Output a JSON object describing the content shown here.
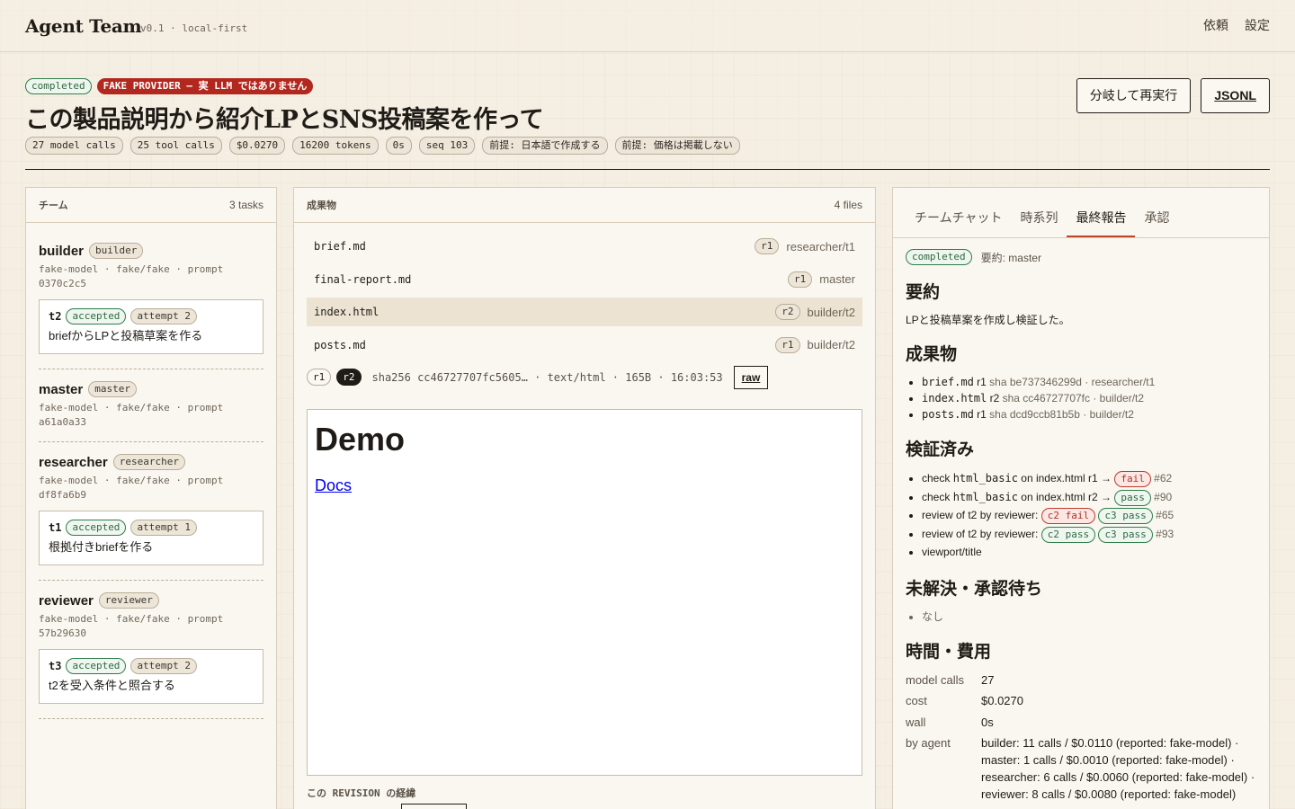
{
  "app": {
    "name": "Agent Team",
    "meta": "v0.1 · local-first"
  },
  "nav": {
    "request": "依頼",
    "settings": "設定"
  },
  "run": {
    "status": "completed",
    "warning": "FAKE PROVIDER — 実 LLM ではありません",
    "title": "この製品説明から紹介LPとSNS投稿案を作って",
    "stats": [
      "27 model calls",
      "25 tool calls",
      "$0.0270",
      "16200 tokens",
      "0s",
      "seq 103",
      "前提: 日本語で作成する",
      "前提: 価格は掲載しない"
    ],
    "fork_label": "分岐して再実行",
    "jsonl_label": "JSONL"
  },
  "team": {
    "title": "チーム",
    "count": "3 tasks",
    "agents": [
      {
        "name": "builder",
        "role": "builder",
        "meta": "fake-model · fake/fake · prompt 0370c2c5",
        "tasks": [
          {
            "id": "t2",
            "status": "accepted",
            "attempt": "attempt 2",
            "desc": "briefからLPと投稿草案を作る"
          }
        ]
      },
      {
        "name": "master",
        "role": "master",
        "meta": "fake-model · fake/fake · prompt a61a0a33",
        "tasks": []
      },
      {
        "name": "researcher",
        "role": "researcher",
        "meta": "fake-model · fake/fake · prompt df8fa6b9",
        "tasks": [
          {
            "id": "t1",
            "status": "accepted",
            "attempt": "attempt 1",
            "desc": "根拠付きbriefを作る"
          }
        ]
      },
      {
        "name": "reviewer",
        "role": "reviewer",
        "meta": "fake-model · fake/fake · prompt 57b29630",
        "tasks": [
          {
            "id": "t3",
            "status": "accepted",
            "attempt": "attempt 2",
            "desc": "t2を受入条件と照合する"
          }
        ]
      }
    ]
  },
  "artifacts": {
    "title": "成果物",
    "count": "4 files",
    "files": [
      {
        "name": "brief.md",
        "rev": "r1",
        "owner": "researcher/t1"
      },
      {
        "name": "final-report.md",
        "rev": "r1",
        "owner": "master"
      },
      {
        "name": "index.html",
        "rev": "r2",
        "owner": "builder/t2"
      },
      {
        "name": "posts.md",
        "rev": "r1",
        "owner": "builder/t2"
      }
    ],
    "revs": [
      "r1",
      "r2"
    ],
    "rev_meta": "sha256 cc46727707fc5605… · text/html · 165B · 16:03:53",
    "raw_label": "raw",
    "preview": {
      "heading": "Demo",
      "link": "Docs"
    },
    "history_label": "この REVISION の経緯"
  },
  "report": {
    "tabs": [
      "チームチャット",
      "時系列",
      "最終報告",
      "承認"
    ],
    "status": "completed",
    "summary_label": "要約: master",
    "sec_summary": "要約",
    "summary_text": "LPと投稿草案を作成し検証した。",
    "sec_artifacts": "成果物",
    "artifacts": [
      {
        "name": "brief.md",
        "rev": "r1",
        "meta": "sha be737346299d · researcher/t1"
      },
      {
        "name": "index.html",
        "rev": "r2",
        "meta": "sha cc46727707fc · builder/t2"
      },
      {
        "name": "posts.md",
        "rev": "r1",
        "meta": "sha dcd9ccb81b5b · builder/t2"
      }
    ],
    "sec_verified": "検証済み",
    "checks": {
      "c1_pre": "check ",
      "c1_code": "html_basic",
      "c1_post": " on index.html r1 →",
      "c1_badge": "fail",
      "c1_ref": "#62",
      "c2_pre": "check ",
      "c2_code": "html_basic",
      "c2_post": " on index.html r2 →",
      "c2_badge": "pass",
      "c2_ref": "#90",
      "r1_text": "review of t2 by reviewer:",
      "r1_b1": "c2 fail",
      "r1_b2": "c3 pass",
      "r1_ref": "#65",
      "r2_text": "review of t2 by reviewer:",
      "r2_b1": "c2 pass",
      "r2_b2": "c3 pass",
      "r2_ref": "#93",
      "vp": "viewport/title"
    },
    "sec_pending": "未解決・承認待ち",
    "pending_none": "なし",
    "sec_cost": "時間・費用",
    "cost": {
      "k1": "model calls",
      "v1": "27",
      "k2": "cost",
      "v2": "$0.0270",
      "k3": "wall",
      "v3": "0s",
      "k4": "by agent",
      "v4": "builder: 11 calls / $0.0110 (reported: fake-model) · master: 1 calls / $0.0010 (reported: fake-model) · researcher: 6 calls / $0.0060 (reported: fake-model) · reviewer: 8 calls / $0.0080 (reported: fake-model)"
    }
  },
  "colors": {
    "accent": "#c0462b",
    "pass": "#2f7d4a",
    "fail": "#c0392b",
    "warn_bg": "#b3281e"
  }
}
